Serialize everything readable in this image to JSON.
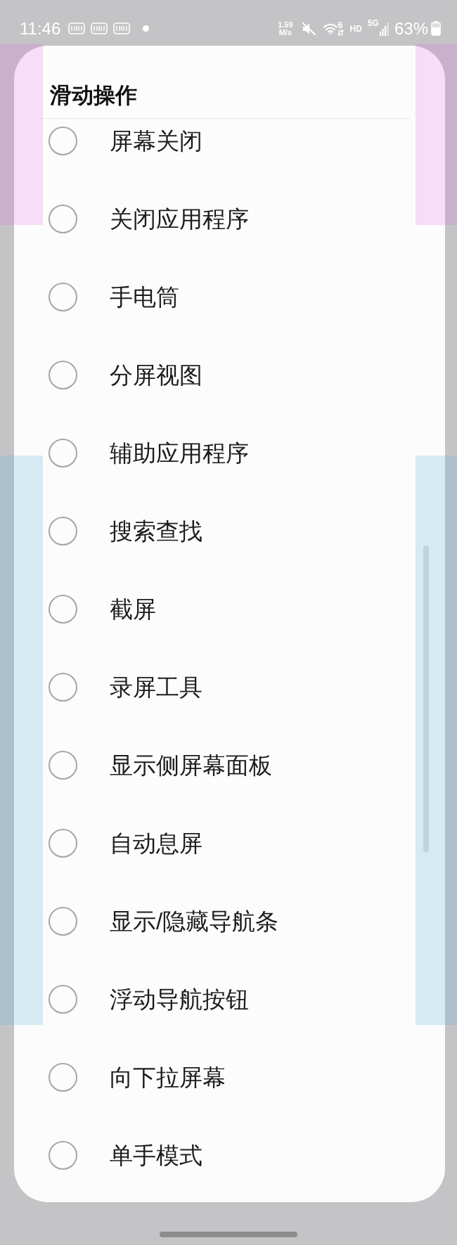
{
  "status_bar": {
    "time": "11:46",
    "network_speed": "1.59",
    "network_speed_unit": "M/s",
    "wifi_generation": "6",
    "call_quality": "HD",
    "network_type": "5G",
    "battery": "63%"
  },
  "dialog": {
    "title": "滑动操作",
    "options": [
      {
        "label": "屏幕关闭",
        "selected": false
      },
      {
        "label": "关闭应用程序",
        "selected": false
      },
      {
        "label": "手电筒",
        "selected": false
      },
      {
        "label": "分屏视图",
        "selected": false
      },
      {
        "label": "辅助应用程序",
        "selected": false
      },
      {
        "label": "搜索查找",
        "selected": false
      },
      {
        "label": "截屏",
        "selected": false
      },
      {
        "label": "录屏工具",
        "selected": false
      },
      {
        "label": "显示侧屏幕面板",
        "selected": false
      },
      {
        "label": "自动息屏",
        "selected": false
      },
      {
        "label": "显示/隐藏导航条",
        "selected": false
      },
      {
        "label": "浮动导航按钮",
        "selected": false
      },
      {
        "label": "向下拉屏幕",
        "selected": false
      },
      {
        "label": "单手模式",
        "selected": false
      }
    ]
  }
}
